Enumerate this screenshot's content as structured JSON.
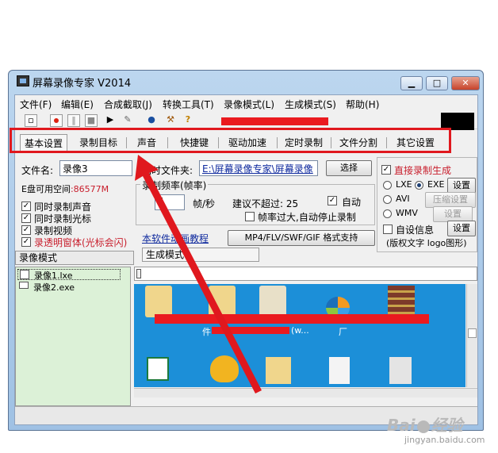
{
  "window": {
    "title": "屏幕录像专家 V2014"
  },
  "title_buttons": {
    "minimize": "▁",
    "maximize": "□",
    "close": "✕"
  },
  "menu": [
    "文件(F)",
    "编辑(E)",
    "合成截取(J)",
    "转换工具(T)",
    "录像模式(L)",
    "生成模式(S)",
    "帮助(H)"
  ],
  "toolbar_icons": [
    "new-file-icon",
    "record-icon",
    "pause-icon",
    "stop-icon",
    "camera-icon",
    "wand-icon",
    "globe-icon",
    "tools-icon",
    "help-icon"
  ],
  "toolbar": {
    "help_glyph": "?"
  },
  "tabs": [
    "基本设置",
    "录制目标",
    "声音",
    "快捷键",
    "驱动加速",
    "定时录制",
    "文件分割",
    "其它设置"
  ],
  "basic": {
    "filename_label": "文件名:",
    "filename_value": "录像3",
    "temp_label": "临时文件夹:",
    "temp_value": "E:\\屏幕录像专家\\屏幕录像",
    "select_button": "选择",
    "free_space_label": "E盘可用空间",
    "free_space_value": ":86577M",
    "fps_group_label": "录制频率(帧率)",
    "fps_value": "5",
    "fps_unit": "帧/秒",
    "fps_suggest": "建议不超过: 25",
    "auto_label": "自动",
    "auto_checked": "✓",
    "auto_stop_label": "帧率过大,自动停止录制",
    "check_items": [
      {
        "label": "同时录制声音",
        "mark": "✓"
      },
      {
        "label": "同时录制光标",
        "mark": "✓"
      },
      {
        "label": "录制视频",
        "mark": "✓"
      },
      {
        "label": "录透明窗体(光标会闪)",
        "mark": "✓"
      }
    ],
    "tutorial_link": "本软件动画教程",
    "format_button": "MP4/FLV/SWF/GIF  格式支持"
  },
  "right_panel": {
    "direct_record": "直接录制生成",
    "direct_checked": "✓",
    "formats": [
      {
        "name": "LXE",
        "selected": false
      },
      {
        "name": "EXE",
        "selected": true
      },
      {
        "name": "AVI",
        "selected": false
      },
      {
        "name": "WMV",
        "selected": false
      }
    ],
    "settings_button": "设置",
    "compress_button": "压缩设置",
    "wmv_settings_button": "设置",
    "custom_info": "自设信息",
    "custom_info_button": "设置",
    "logo_note": "(版权文字 logo图形)"
  },
  "lower": {
    "record_mode_tab": "录像模式",
    "generate_mode_tab": "生成模式",
    "files": [
      "录像1.lxe",
      "录像2.exe"
    ],
    "desktop_snippet": "件",
    "desktop_snippet2": "(w...",
    "desktop_snippet3": "厂"
  },
  "watermark": {
    "brand": "Bai",
    "brand2": "经验",
    "url": "jingyan.baidu.com"
  },
  "colors": {
    "annotation_red": "#e0181e",
    "list_green": "#dcf1d7",
    "desktop_blue": "#1c8fd8",
    "link_blue": "#0f2a9e"
  }
}
